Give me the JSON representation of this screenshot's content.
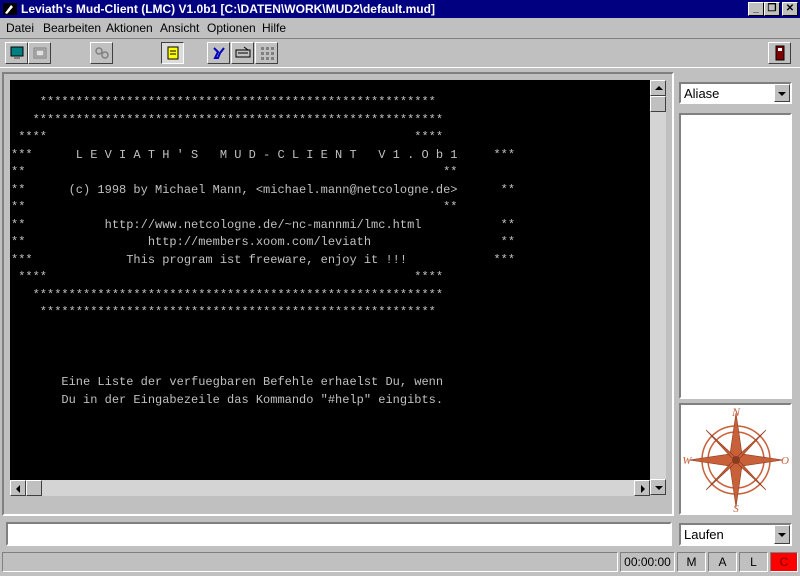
{
  "window": {
    "title": "Leviath's Mud-Client (LMC) V1.0b1 [C:\\DATEN\\WORK\\MUD2\\default.mud]",
    "controls": {
      "minimize": "_",
      "maximize": "❐",
      "close": "✕"
    }
  },
  "menu": [
    "Datei",
    "Bearbeiten",
    "Aktionen",
    "Ansicht",
    "Optionen",
    "Hilfe"
  ],
  "toolbar": {
    "icons": [
      "monitor-icon",
      "window-icon",
      "connect-icon",
      "notes-icon",
      "tools-icon",
      "keyboard-icon",
      "grid-icon",
      "phone-icon"
    ]
  },
  "output": {
    "lines": [
      "    *******************************************************",
      "   *********************************************************",
      " ****                                                   ****",
      "***      L E V I A T H ' S   M U D - C L I E N T   V 1 . O b 1     ***",
      "**                                                          **",
      "**      (c) 1998 by Michael Mann, <michael.mann@netcologne.de>      **",
      "**                                                          **",
      "**           http://www.netcologne.de/~nc-mannmi/lmc.html           **",
      "**                 http://members.xoom.com/leviath                  **",
      "***             This program ist freeware, enjoy it !!!            ***",
      " ****                                                   ****",
      "   *********************************************************",
      "    *******************************************************",
      "",
      "",
      "",
      "       Eine Liste der verfuegbaren Befehle erhaelst Du, wenn",
      "       Du in der Eingabezeile das Kommando \"#help\" eingibts."
    ]
  },
  "side": {
    "list_select": "Aliase",
    "compass": {
      "n": "N",
      "e": "O",
      "s": "S",
      "w": "W"
    }
  },
  "input": {
    "value": ""
  },
  "move_select": "Laufen",
  "status": {
    "timer": "00:00:00",
    "m": "M",
    "a": "A",
    "l": "L",
    "c": "C"
  },
  "colors": {
    "title_bg": "#000080",
    "terminal_bg": "#000000",
    "terminal_fg": "#c0c0c0",
    "compass": "#c8603a",
    "status_alert": "#ff0000"
  }
}
